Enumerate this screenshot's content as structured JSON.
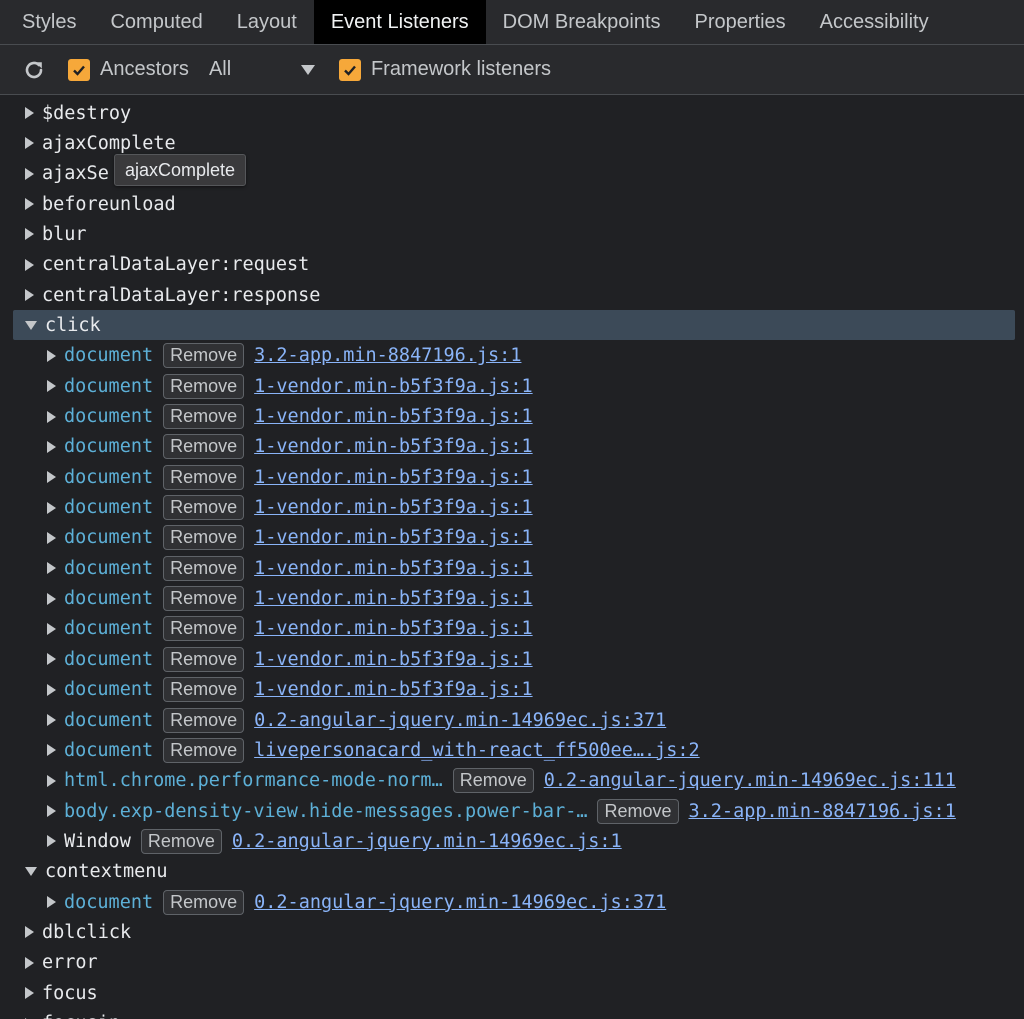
{
  "tabs": [
    "Styles",
    "Computed",
    "Layout",
    "Event Listeners",
    "DOM Breakpoints",
    "Properties",
    "Accessibility"
  ],
  "active_tab": "Event Listeners",
  "toolbar": {
    "refresh_icon": "refresh-icon",
    "ancestors_label": "Ancestors",
    "ancestors_checked": true,
    "filter_value": "All",
    "framework_label": "Framework listeners",
    "framework_checked": true
  },
  "accent_color": "#f6a83a",
  "remove_label": "Remove",
  "tooltip": "ajaxComplete",
  "rows": [
    {
      "kind": "event",
      "name": "$destroy",
      "expanded": false
    },
    {
      "kind": "event",
      "name": "ajaxComplete",
      "expanded": false
    },
    {
      "kind": "event",
      "name": "ajaxSe",
      "expanded": false
    },
    {
      "kind": "event",
      "name": "beforeunload",
      "expanded": false
    },
    {
      "kind": "event",
      "name": "blur",
      "expanded": false
    },
    {
      "kind": "event",
      "name": "centralDataLayer:request",
      "expanded": false
    },
    {
      "kind": "event",
      "name": "centralDataLayer:response",
      "expanded": false
    },
    {
      "kind": "event",
      "name": "click",
      "expanded": true,
      "selected": true
    },
    {
      "kind": "listener",
      "node": "document",
      "source": "3.2-app.min-8847196.js:1"
    },
    {
      "kind": "listener",
      "node": "document",
      "source": "1-vendor.min-b5f3f9a.js:1"
    },
    {
      "kind": "listener",
      "node": "document",
      "source": "1-vendor.min-b5f3f9a.js:1"
    },
    {
      "kind": "listener",
      "node": "document",
      "source": "1-vendor.min-b5f3f9a.js:1"
    },
    {
      "kind": "listener",
      "node": "document",
      "source": "1-vendor.min-b5f3f9a.js:1"
    },
    {
      "kind": "listener",
      "node": "document",
      "source": "1-vendor.min-b5f3f9a.js:1"
    },
    {
      "kind": "listener",
      "node": "document",
      "source": "1-vendor.min-b5f3f9a.js:1"
    },
    {
      "kind": "listener",
      "node": "document",
      "source": "1-vendor.min-b5f3f9a.js:1"
    },
    {
      "kind": "listener",
      "node": "document",
      "source": "1-vendor.min-b5f3f9a.js:1"
    },
    {
      "kind": "listener",
      "node": "document",
      "source": "1-vendor.min-b5f3f9a.js:1"
    },
    {
      "kind": "listener",
      "node": "document",
      "source": "1-vendor.min-b5f3f9a.js:1"
    },
    {
      "kind": "listener",
      "node": "document",
      "source": "1-vendor.min-b5f3f9a.js:1"
    },
    {
      "kind": "listener",
      "node": "document",
      "source": "0.2-angular-jquery.min-14969ec.js:371"
    },
    {
      "kind": "listener",
      "node": "document",
      "source": "livepersonacard_with-react_ff500ee….js:2"
    },
    {
      "kind": "listener",
      "node": "html.chrome.performance-mode-norm…",
      "source": "0.2-angular-jquery.min-14969ec.js:111"
    },
    {
      "kind": "listener",
      "node": "body.exp-density-view.hide-messages.power-bar-…",
      "source": "3.2-app.min-8847196.js:1"
    },
    {
      "kind": "listener",
      "node": "Window",
      "plain": true,
      "source": "0.2-angular-jquery.min-14969ec.js:1"
    },
    {
      "kind": "event",
      "name": "contextmenu",
      "expanded": true
    },
    {
      "kind": "listener",
      "node": "document",
      "source": "0.2-angular-jquery.min-14969ec.js:371"
    },
    {
      "kind": "event",
      "name": "dblclick",
      "expanded": false
    },
    {
      "kind": "event",
      "name": "error",
      "expanded": false
    },
    {
      "kind": "event",
      "name": "focus",
      "expanded": false
    },
    {
      "kind": "event",
      "name": "focusin",
      "expanded": false
    }
  ]
}
